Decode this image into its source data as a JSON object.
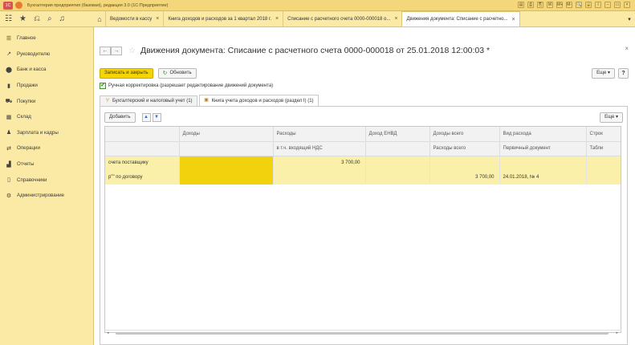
{
  "app": {
    "logo_text": "1С",
    "title": "Бухгалтерия предприятия (базовая), редакция 3.0 (1С:Предприятие)",
    "tools": [
      "▤",
      "⎙",
      "⎘",
      "M",
      "M+",
      "M-",
      "🔍",
      "🔒",
      "i",
      "–",
      "▭",
      "×"
    ]
  },
  "tabs": [
    {
      "label": "Ведомости в кассу",
      "close": "×"
    },
    {
      "label": "Книга доходов и расходов за 1 квартал 2018 г.",
      "close": "×"
    },
    {
      "label": "Списание с расчетного счета 0000-000018 о...",
      "close": "×"
    },
    {
      "label": "Движения документа: Списание с расчетно...",
      "close": "×"
    }
  ],
  "sidebar": {
    "items": [
      {
        "icon": "☰",
        "label": "Главное"
      },
      {
        "icon": "↗",
        "label": "Руководителю"
      },
      {
        "icon": "⬤",
        "label": "Банк и касса"
      },
      {
        "icon": "▮",
        "label": "Продажи"
      },
      {
        "icon": "⛟",
        "label": "Покупки"
      },
      {
        "icon": "▦",
        "label": "Склад"
      },
      {
        "icon": "♟",
        "label": "Зарплата и кадры"
      },
      {
        "icon": "⇄",
        "label": "Операции"
      },
      {
        "icon": "▟",
        "label": "Отчеты"
      },
      {
        "icon": "▯",
        "label": "Справочники"
      },
      {
        "icon": "⚙",
        "label": "Администрирование"
      }
    ]
  },
  "document": {
    "title": "Движения документа: Списание с расчетного счета 0000-000018 от 25.01.2018 12:00:03 *",
    "back": "←",
    "forward": "→",
    "star": "☆",
    "close": "×"
  },
  "commands": {
    "save_close": "Записать и закрыть",
    "refresh": "Обновить",
    "more": "Еще ▾",
    "help": "?"
  },
  "manual_adjustment": {
    "checked": true,
    "label": "Ручная корректировка (разрешает редактирование движений документа)"
  },
  "subtabs": [
    {
      "label": "Бухгалтерский и налоговый учет (1)"
    },
    {
      "label": "Книга учета доходов и расходов (раздел I) (1)"
    }
  ],
  "grid_bar": {
    "add": "Добавить",
    "up": "▲",
    "down": "▼",
    "more": "Еще ▾"
  },
  "table": {
    "headers_row1": [
      "",
      "Доходы",
      "Расходы",
      "Доход ЕНВД",
      "Доходы всего",
      "Вид расхода",
      "Строк"
    ],
    "headers_row2": [
      "",
      "",
      "в т.ч. входящий НДС",
      "",
      "Расходы всего",
      "Первичный документ",
      "Табли"
    ],
    "row": {
      "desc_line1": "счета поставщику",
      "desc_line2": "р\"\" по договору",
      "expense": "3 700,00",
      "total_expenses": "3 700,00",
      "primary_doc": "24.01.2018, № 4"
    }
  },
  "scrollbar": {
    "left": "◂",
    "right": "▸"
  }
}
